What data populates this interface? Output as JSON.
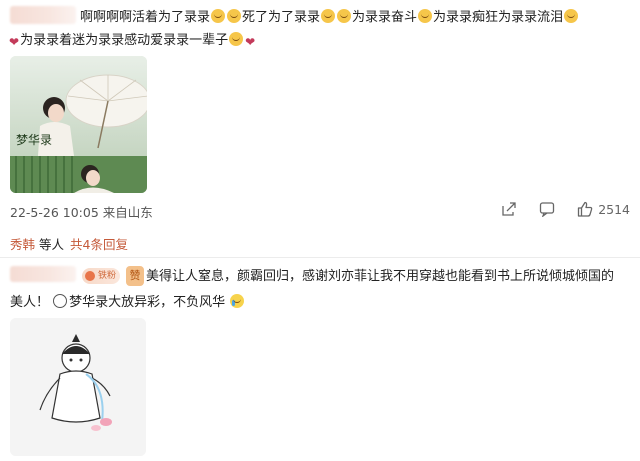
{
  "post": {
    "line1": "啊啊啊啊活着为了录录",
    "line1b": "死了为了录录",
    "line1c": "为录录奋斗",
    "line1d": "为录录痴狂",
    "line1e": "为录录流泪",
    "line2a": "为录录着迷",
    "line2b": "为录录感动",
    "line2c": "爱录录一辈子",
    "meta": "22-5-26 10:05 来自山东",
    "like_count": "2514",
    "image_watermark": "梦华录"
  },
  "replies": {
    "name": "秀韩",
    "text": "等人",
    "more": "共4条回复"
  },
  "comment": {
    "fans_badge": "铁粉",
    "zan_badge": "赞",
    "text1": "美得让人窒息，颜霸回归，感谢刘亦菲让我不用穿越也能看到书上所说倾城倾国的",
    "text2": "美人！",
    "topic": "梦华录大放异彩",
    "text3": "，不负风华"
  },
  "colors": {
    "accent": "#c55a3a",
    "meta": "#555555"
  },
  "icons": {
    "share": "share-icon",
    "comment": "comment-icon",
    "like": "thumbs-up-icon"
  }
}
